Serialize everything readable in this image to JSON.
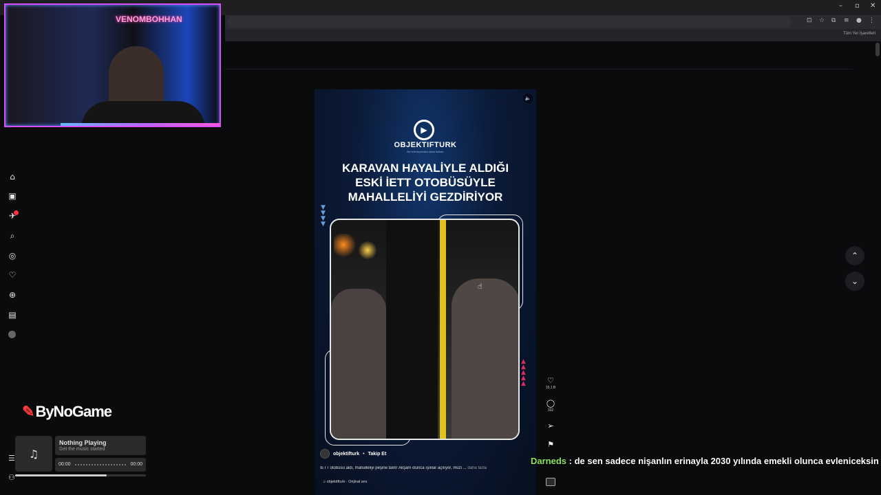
{
  "browser": {
    "minimize_label": "–",
    "maximize_label": "▫",
    "close_label": "✕",
    "toolbar_icons": [
      "install-icon",
      "star-icon",
      "extensions-icon",
      "media-icon",
      "profile-icon",
      "menu-icon"
    ],
    "bookmarks_label": "Tüm Yer İşaretleri"
  },
  "webcam": {
    "neon_sign": "VENOMBOHHAN"
  },
  "sidebar": {
    "items": [
      {
        "name": "home-icon",
        "glyph": "⌂"
      },
      {
        "name": "reels-icon",
        "glyph": "▣"
      },
      {
        "name": "messages-icon",
        "glyph": "✈"
      },
      {
        "name": "search-icon",
        "glyph": "⌕"
      },
      {
        "name": "explore-icon",
        "glyph": "◎"
      },
      {
        "name": "heart-icon",
        "glyph": "♡"
      },
      {
        "name": "create-icon",
        "glyph": "⊕"
      },
      {
        "name": "dashboard-icon",
        "glyph": "▤"
      }
    ],
    "more_icon": "☰",
    "apps_icon": "⚇"
  },
  "sponsor": {
    "logo_text": "ByNoGame",
    "logo_mark": "✎"
  },
  "player": {
    "title": "Nothing Playing",
    "subtitle": "Get the music started",
    "time_start": "00:00",
    "time_end": "00:00",
    "art_icon": "♫",
    "progress": 0.7
  },
  "reel": {
    "mute_icon": "🔈",
    "brand_name": "OBJEKTIFTURK",
    "brand_tagline": "Bir televizyondan daha fazlası",
    "headline_lines": [
      "KARAVAN HAYALİYLE ALDIĞI",
      "ESKİ İETT OTOBÜSÜYLE",
      "MAHALLELİYİ GEZDİRİYOR"
    ],
    "author": "objektifturk",
    "separator": "•",
    "follow_label": "Takip Et",
    "caption": "İETT otobüsü aldı, mahalleliyi peşine taktı! Akşam olunca ışıklar açılıyor, müzi ...",
    "more_label": "daha fazla",
    "audio": "♫ objektifturk · Orijinal ses"
  },
  "actions": {
    "like_icon": "♡",
    "like_count": "15,1 B",
    "comment_icon": "◯",
    "comment_count": "332",
    "share_icon": "➢",
    "save_icon": "⚑"
  },
  "nav": {
    "up_icon": "⌃",
    "down_icon": "⌄"
  },
  "chat": {
    "user": "Darneds",
    "message": " : de sen sadece nişanlın erinayla 2030 yılında emekli olunca evleniceksin"
  }
}
